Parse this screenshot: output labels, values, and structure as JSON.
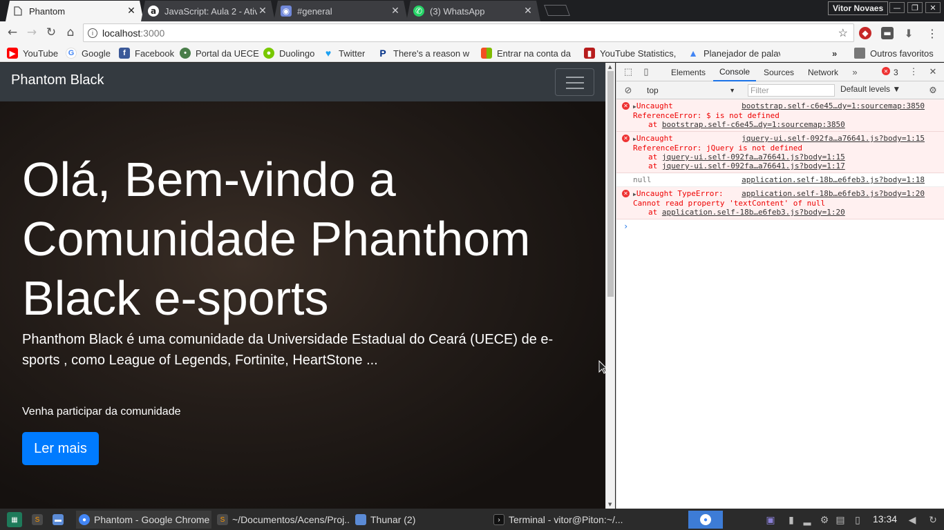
{
  "browser": {
    "tabs": [
      {
        "title": "Phantom",
        "active": true
      },
      {
        "title": "JavaScript: Aula 2 - Ativ"
      },
      {
        "title": "#general"
      },
      {
        "title": "(3) WhatsApp"
      }
    ],
    "profile_name": "Vitor Novaes",
    "url_host": "localhost",
    "url_port": ":3000",
    "bookmarks": [
      "YouTube",
      "Google",
      "Facebook",
      "Portal da UECE",
      "Duolingo",
      "Twitter",
      "There's a reason wh",
      "Entrar na conta da M",
      "YouTube Statistics,",
      "Planejador de palavr",
      "Outros favoritos"
    ],
    "bookmarks_overflow": "»"
  },
  "page": {
    "brand": "Phantom Black",
    "hero_title": "Olá, Bem-vindo a Comunidade Phanthom Black e-sports",
    "hero_lead": "Phanthom Black é uma comunidade da Universidade Estadual do Ceará (UECE) de e-sports , como League of Legends, Fortinite, HeartStone ...",
    "hero_sub": "Venha participar da comunidade",
    "cta_label": "Ler mais"
  },
  "devtools": {
    "tabs": [
      "Elements",
      "Console",
      "Sources",
      "Network"
    ],
    "active_tab": "Console",
    "error_count": "3",
    "context": "top",
    "filter_placeholder": "Filter",
    "levels": "Default levels ▼",
    "messages": [
      {
        "type": "error",
        "head": "Uncaught",
        "src": "bootstrap.self-c6e45…dy=1:sourcemap:3850",
        "body": "ReferenceError: $ is not defined",
        "stack": [
          "bootstrap.self-c6e45…dy=1:sourcemap:3850"
        ]
      },
      {
        "type": "error",
        "head": "Uncaught",
        "src": "jquery-ui.self-092fa…a76641.js?body=1:15",
        "body": "ReferenceError: jQuery is not defined",
        "stack": [
          "jquery-ui.self-092fa…a76641.js?body=1:15",
          "jquery-ui.self-092fa…a76641.js?body=1:17"
        ]
      },
      {
        "type": "log",
        "head": "null",
        "src": "application.self-18b…e6feb3.js?body=1:18"
      },
      {
        "type": "error",
        "head": "Uncaught TypeError:",
        "src": "application.self-18b…e6feb3.js?body=1:20",
        "body": "Cannot read property 'textContent' of null",
        "stack": [
          "application.self-18b…e6feb3.js?body=1:20"
        ]
      }
    ],
    "stack_prefix": "at "
  },
  "taskbar": {
    "items": [
      "Phantom - Google Chrome",
      "~/Documentos/Acens/Proj...",
      "Thunar (2)",
      "Terminal - vitor@Piton:~/..."
    ],
    "clock": "13:34"
  }
}
